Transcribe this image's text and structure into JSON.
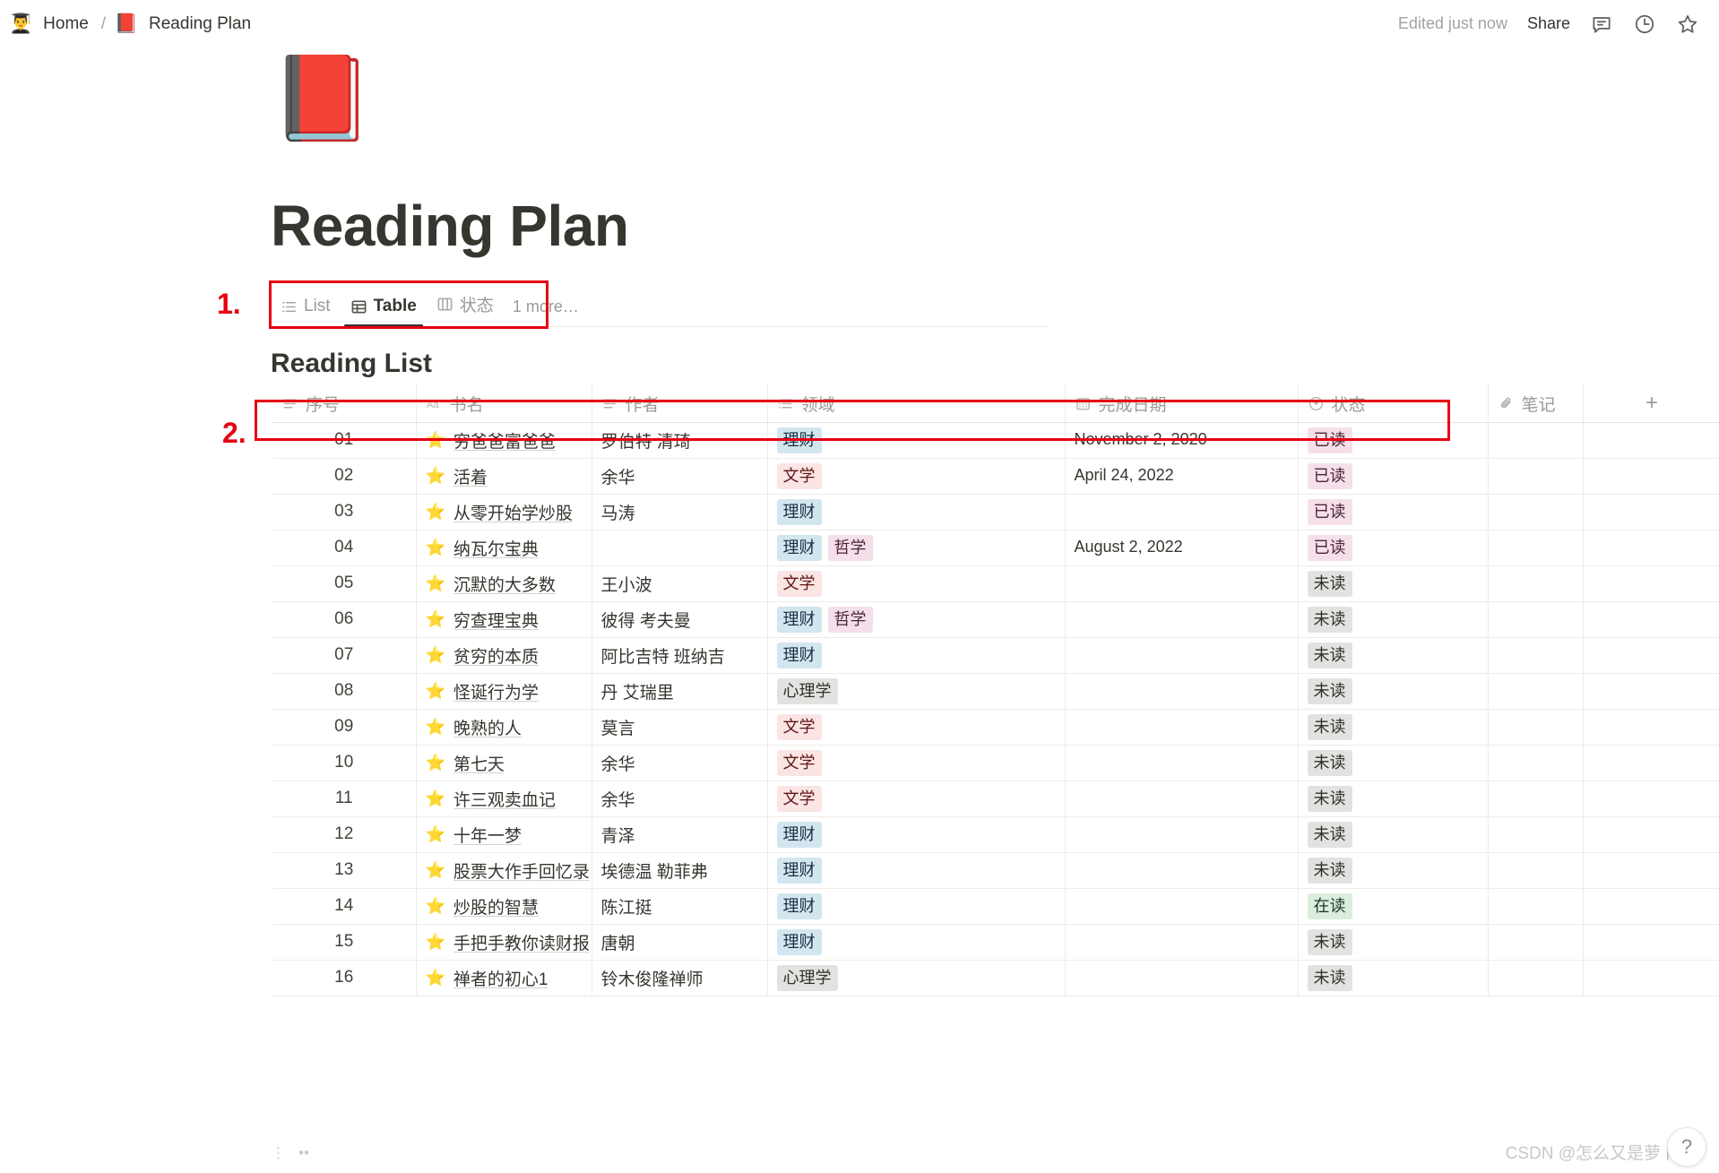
{
  "topbar": {
    "breadcrumb": {
      "home_emoji": "👨‍🎓",
      "home_label": "Home",
      "separator": "/",
      "page_emoji": "📕",
      "page_label": "Reading Plan"
    },
    "edited_status": "Edited just now",
    "share_label": "Share",
    "icons": {
      "comment": "comment-icon",
      "history": "clock-history-icon",
      "favorite": "star-outline-icon"
    }
  },
  "page": {
    "cover_emoji": "📕",
    "title": "Reading Plan"
  },
  "views": {
    "tabs": [
      {
        "label": "List",
        "icon": "list-view-icon",
        "active": false
      },
      {
        "label": "Table",
        "icon": "table-view-icon",
        "active": true
      },
      {
        "label": "状态",
        "icon": "board-view-icon",
        "active": false
      }
    ],
    "more_label": "1 more…"
  },
  "annotations": [
    {
      "number": "1."
    },
    {
      "number": "2."
    }
  ],
  "database": {
    "title": "Reading List",
    "add_column_label": "+",
    "menu_label": "•••",
    "columns": [
      {
        "label": "序号",
        "icon": "text-property-icon"
      },
      {
        "label": "书名",
        "icon": "title-property-icon"
      },
      {
        "label": "作者",
        "icon": "text-property-icon"
      },
      {
        "label": "领域",
        "icon": "multiselect-property-icon"
      },
      {
        "label": "完成日期",
        "icon": "date-property-icon"
      },
      {
        "label": "状态",
        "icon": "select-property-icon"
      },
      {
        "label": "笔记",
        "icon": "attachment-property-icon"
      }
    ],
    "tag_colors": {
      "理财": {
        "bg": "#d3e5ef",
        "fg": "#183347"
      },
      "文学": {
        "bg": "#fbe4e4",
        "fg": "#5d1715"
      },
      "哲学": {
        "bg": "#f4dfeb",
        "fg": "#4c2337"
      },
      "心理学": {
        "bg": "#e3e2e0",
        "fg": "#32302c"
      }
    },
    "status_colors": {
      "已读": {
        "bg": "#f5e0e9",
        "fg": "#4c2337"
      },
      "未读": {
        "bg": "#e3e2e0",
        "fg": "#32302c"
      },
      "在读": {
        "bg": "#dbeddb",
        "fg": "#1c3829"
      }
    },
    "rows": [
      {
        "序号": "01",
        "star": "⭐",
        "书名": "穷爸爸富爸爸",
        "作者": "罗伯特 清琦",
        "领域": [
          "理财"
        ],
        "完成日期": "November 2, 2020",
        "状态": "已读",
        "笔记": ""
      },
      {
        "序号": "02",
        "star": "⭐",
        "书名": "活着",
        "作者": "余华",
        "领域": [
          "文学"
        ],
        "完成日期": "April 24, 2022",
        "状态": "已读",
        "笔记": ""
      },
      {
        "序号": "03",
        "star": "⭐",
        "书名": "从零开始学炒股",
        "作者": "马涛",
        "领域": [
          "理财"
        ],
        "完成日期": "",
        "状态": "已读",
        "笔记": ""
      },
      {
        "序号": "04",
        "star": "⭐",
        "书名": "纳瓦尔宝典",
        "作者": "",
        "领域": [
          "理财",
          "哲学"
        ],
        "完成日期": "August 2, 2022",
        "状态": "已读",
        "笔记": ""
      },
      {
        "序号": "05",
        "star": "⭐",
        "书名": "沉默的大多数",
        "作者": "王小波",
        "领域": [
          "文学"
        ],
        "完成日期": "",
        "状态": "未读",
        "笔记": ""
      },
      {
        "序号": "06",
        "star": "⭐",
        "书名": "穷查理宝典",
        "作者": "彼得 考夫曼",
        "领域": [
          "理财",
          "哲学"
        ],
        "完成日期": "",
        "状态": "未读",
        "笔记": ""
      },
      {
        "序号": "07",
        "star": "⭐",
        "书名": "贫穷的本质",
        "作者": "阿比吉特 班纳吉",
        "领域": [
          "理财"
        ],
        "完成日期": "",
        "状态": "未读",
        "笔记": ""
      },
      {
        "序号": "08",
        "star": "⭐",
        "书名": "怪诞行为学",
        "作者": "丹 艾瑞里",
        "领域": [
          "心理学"
        ],
        "完成日期": "",
        "状态": "未读",
        "笔记": ""
      },
      {
        "序号": "09",
        "star": "⭐",
        "书名": "晚熟的人",
        "作者": "莫言",
        "领域": [
          "文学"
        ],
        "完成日期": "",
        "状态": "未读",
        "笔记": ""
      },
      {
        "序号": "10",
        "star": "⭐",
        "书名": "第七天",
        "作者": "余华",
        "领域": [
          "文学"
        ],
        "完成日期": "",
        "状态": "未读",
        "笔记": ""
      },
      {
        "序号": "11",
        "star": "⭐",
        "书名": "许三观卖血记",
        "作者": "余华",
        "领域": [
          "文学"
        ],
        "完成日期": "",
        "状态": "未读",
        "笔记": ""
      },
      {
        "序号": "12",
        "star": "⭐",
        "书名": "十年一梦",
        "作者": "青泽",
        "领域": [
          "理财"
        ],
        "完成日期": "",
        "状态": "未读",
        "笔记": ""
      },
      {
        "序号": "13",
        "star": "⭐",
        "书名": "股票大作手回忆录",
        "作者": "埃德温 勒菲弗",
        "领域": [
          "理财"
        ],
        "完成日期": "",
        "状态": "未读",
        "笔记": ""
      },
      {
        "序号": "14",
        "star": "⭐",
        "书名": "炒股的智慧",
        "作者": "陈江挺",
        "领域": [
          "理财"
        ],
        "完成日期": "",
        "状态": "在读",
        "笔记": ""
      },
      {
        "序号": "15",
        "star": "⭐",
        "书名": "手把手教你读财报",
        "作者": "唐朝",
        "领域": [
          "理财"
        ],
        "完成日期": "",
        "状态": "未读",
        "笔记": ""
      },
      {
        "序号": "16",
        "star": "⭐",
        "书名": "禅者的初心1",
        "作者": "铃木俊隆禅师",
        "领域": [
          "心理学"
        ],
        "完成日期": "",
        "状态": "未读",
        "笔记": ""
      }
    ]
  },
  "footer": {
    "drag_handle": "⋮",
    "options_handle": "••",
    "watermark": "CSDN @怎么又是萝卜",
    "help_label": "?"
  }
}
